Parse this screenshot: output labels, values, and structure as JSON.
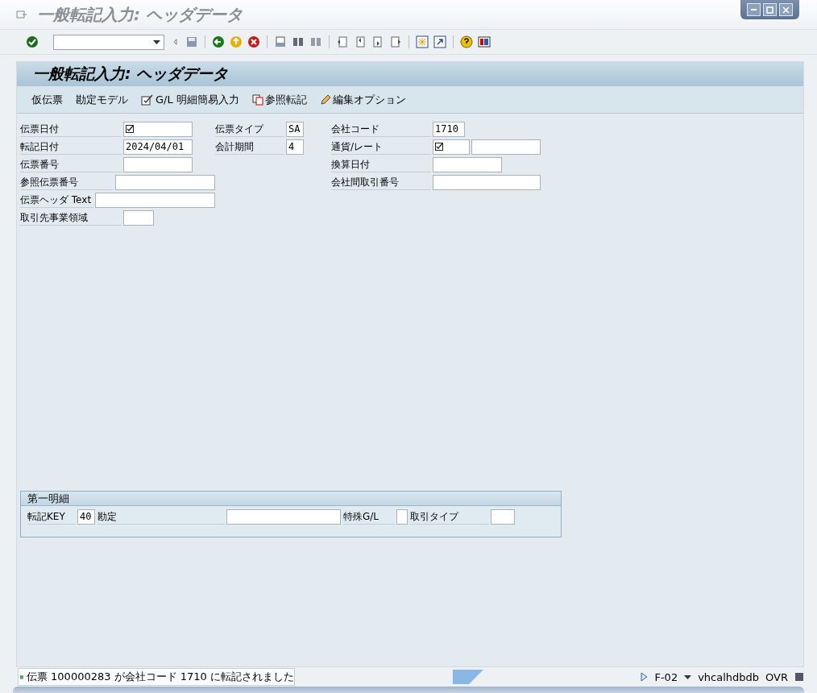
{
  "window": {
    "title": "一般転記入力: ヘッダデータ"
  },
  "panel": {
    "title": "一般転記入力: ヘッダデータ"
  },
  "app_toolbar": [
    {
      "label": "仮伝票"
    },
    {
      "label": "勘定モデル"
    },
    {
      "label": "G/L 明細簡易入力"
    },
    {
      "label": "参照転記"
    },
    {
      "label": "編集オプション"
    }
  ],
  "header_fields": {
    "left": [
      {
        "label": "伝票日付",
        "required": true
      },
      {
        "label": "転記日付",
        "value": "2024/04/01",
        "required": false
      },
      {
        "label": "伝票番号",
        "required": false
      },
      {
        "label": "参照伝票番号",
        "required": false
      },
      {
        "label": "伝票ヘッダ Text",
        "required": false
      },
      {
        "label": "取引先事業領域",
        "required": false
      }
    ],
    "middle": [
      {
        "label": "伝票タイプ",
        "value": "SA",
        "required": false
      },
      {
        "label": "会計期間",
        "value": "4",
        "required": false
      }
    ],
    "right": [
      {
        "label": "会社コード",
        "value": "1710",
        "required": false
      },
      {
        "label": "通貨/レート",
        "required": true
      },
      {
        "label": "換算日付",
        "required": false
      },
      {
        "label": "会社間取引番号",
        "required": false
      }
    ]
  },
  "first_item": {
    "title": "第一明細",
    "fields": [
      {
        "label": "転記KEY",
        "value": "40"
      },
      {
        "label": "勘定"
      },
      {
        "label": "特殊G/L"
      },
      {
        "label": "取引タイプ"
      }
    ]
  },
  "status_bar": {
    "message": "伝票 100000283 が会社コード 1710 に転記されました",
    "transaction": "F-02",
    "server": "vhcalhdbdb",
    "mode": "OVR"
  }
}
